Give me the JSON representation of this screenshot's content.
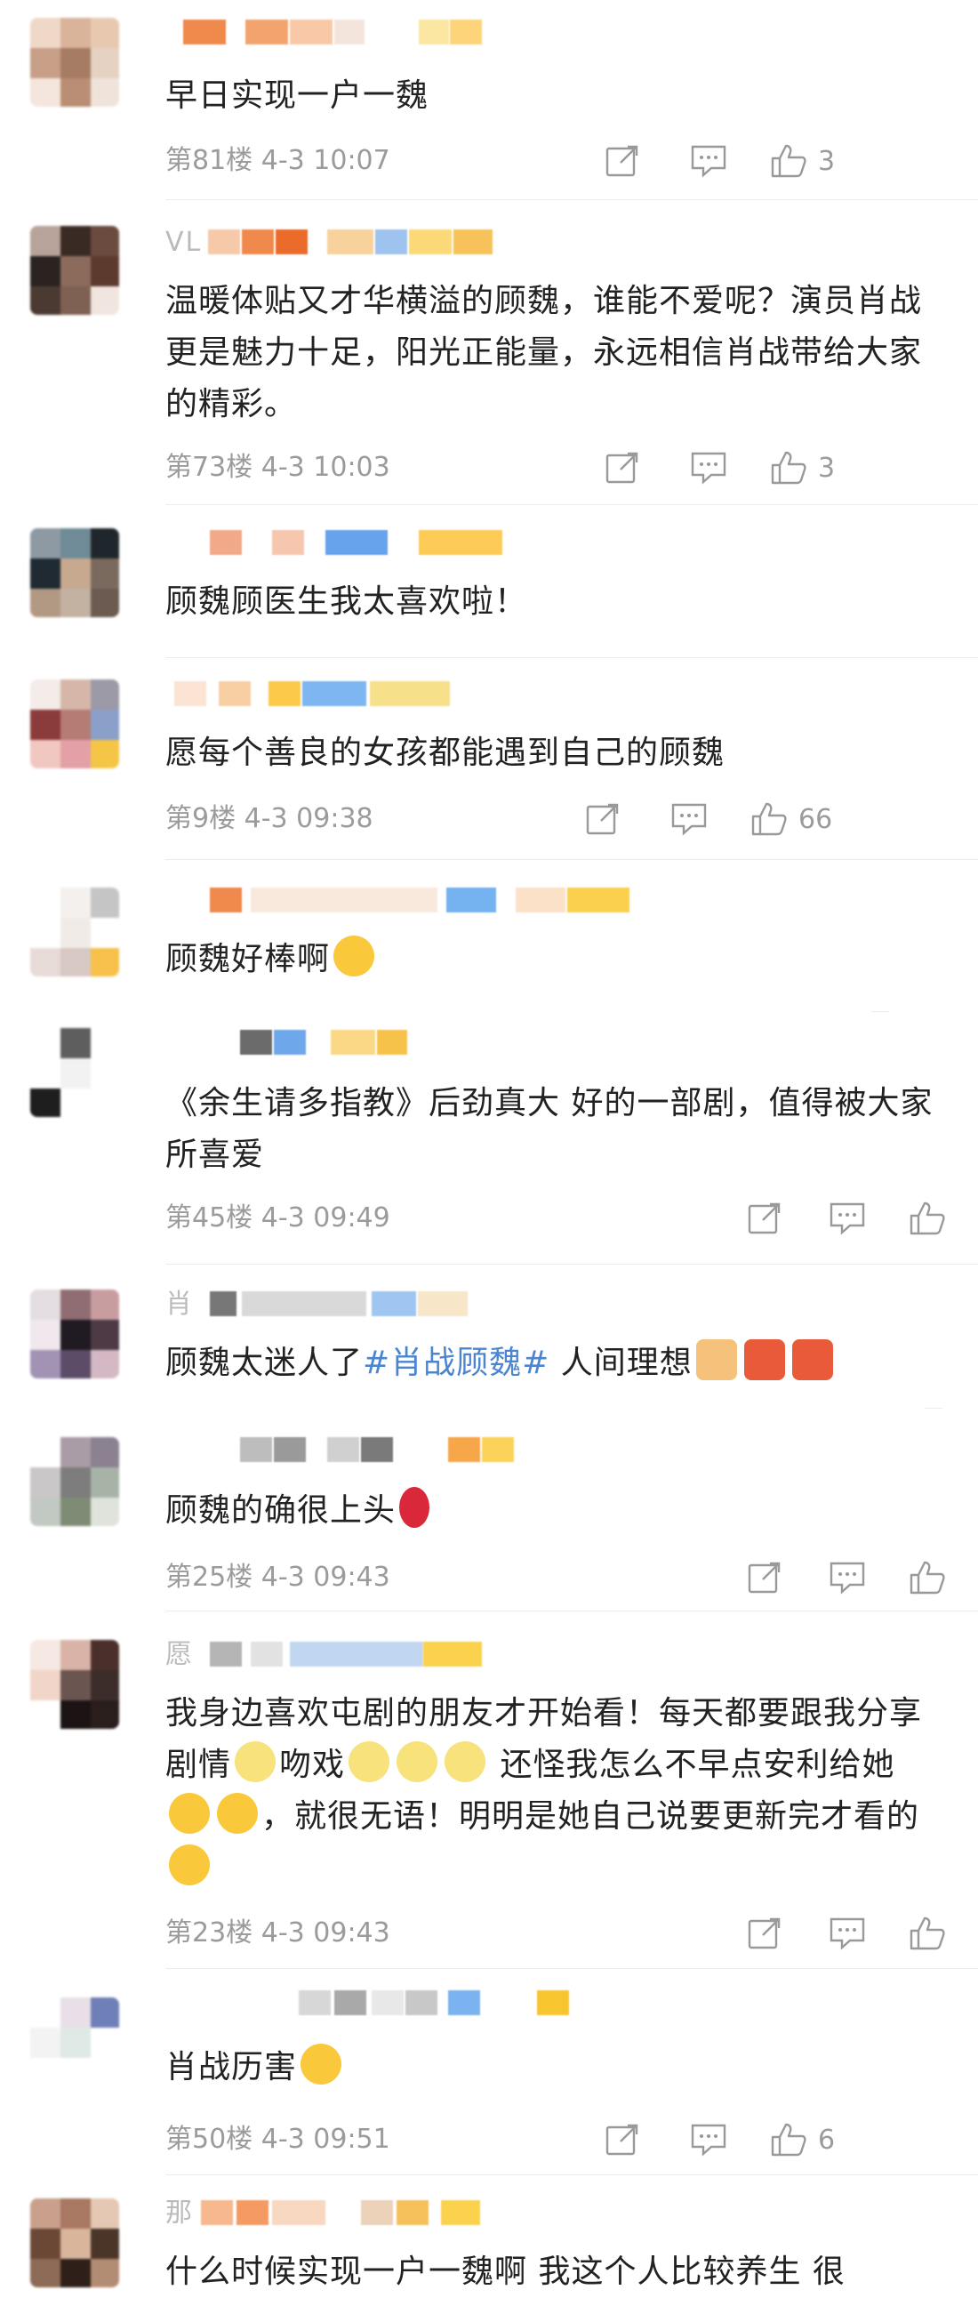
{
  "comments": [
    {
      "avatar": [
        "#f0d8c8",
        "#d9b39a",
        "#e8c9b0",
        "#c79e86",
        "#a77c65",
        "#e6d2c2"
      ],
      "name_prefix": "",
      "name_blocks": [
        "#f08a4c",
        "#f3a46e",
        "#f9c9a7",
        "#f3e5dc",
        "#fbe6a2",
        "#fdd47a"
      ],
      "text": "早日实现一户一魏",
      "floor": "第81楼",
      "time": "4-3 10:07",
      "likes": "3"
    },
    {
      "avatar": [
        "#b8a39a",
        "#3a2a24",
        "#6b4a3f",
        "#2b2320",
        "#8c6b5d",
        "#f1e5e0"
      ],
      "name_prefix": "VL",
      "name_blocks": [
        "#f6c9a8",
        "#f08a4c",
        "#ea6b2a",
        "#f8d29c",
        "#9ec3ee",
        "#fbd978",
        "#f7c25a"
      ],
      "text": "温暖体贴又才华横溢的顾魏，谁能不爱呢？演员肖战更是魅力十足，阳光正能量，永远相信肖战带给大家的精彩。",
      "floor": "第73楼",
      "time": "4-3 10:03",
      "likes": "3"
    },
    {
      "avatar": [
        "#8d9aa3",
        "#6f8b97",
        "#20272c",
        "#c7a98f",
        "#b29984",
        "#7a6a5d"
      ],
      "name_prefix": "",
      "name_blocks": [
        "#f2a98a",
        "#f6c6ae",
        "#66a3ec",
        "#fccb55"
      ],
      "text": "顾魏顾医生我太喜欢啦！",
      "floor": "",
      "time": "",
      "likes": ""
    },
    {
      "avatar": [
        "#f4ece8",
        "#d6b6a8",
        "#9b9aa6",
        "#8b3b3a",
        "#b57c74",
        "#8aa0c8"
      ],
      "name_prefix": "",
      "name_blocks": [
        "#fbe4d4",
        "#f8cfa3",
        "#fcc94a",
        "#7eb6f2",
        "#f7e08a"
      ],
      "text": "愿每个善良的女孩都能遇到自己的顾魏",
      "floor": "第9楼",
      "time": "4-3 09:38",
      "likes": "66"
    },
    {
      "avatar": [
        "#ffffff",
        "#f4f0ee",
        "#c5c5c5",
        "#ffffff",
        "#d7c8c3",
        "#f6c04b"
      ],
      "name_prefix": "",
      "name_blocks": [
        "#f08a4c",
        "#f7e0d0",
        "#74b3ef",
        "#fbe1c8",
        "#fcd04f"
      ],
      "text": "顾魏好棒啊",
      "floor": "",
      "time": "",
      "likes": ""
    },
    {
      "avatar": [
        "#ffffff",
        "#5e5e5e",
        "#ffffff",
        "#ffffff",
        "#1e1e1e",
        "#ffffff"
      ],
      "name_prefix": "",
      "name_blocks": [
        "#6b6b6b",
        "#6fa7eb",
        "#fbd886",
        "#f7c24a"
      ],
      "text": "《余生请多指教》后劲真大 好的一部剧，值得被大家所喜爱",
      "floor": "第45楼",
      "time": "4-3 09:49",
      "likes": ""
    },
    {
      "avatar": [
        "#e4dde2",
        "#8f6d73",
        "#c89da0",
        "#201a22",
        "#4d3a45",
        "#a293b5"
      ],
      "name_prefix": "肖",
      "name_blocks": [
        "#777777",
        "#c0c0c0",
        "#9fc6f1",
        "#f7e6c8"
      ],
      "text": "顾魏太迷人了#肖战顾魏# 人间理想",
      "floor": "",
      "time": "",
      "likes": ""
    },
    {
      "avatar": [
        "#a99ca6",
        "#8c8190",
        "#c9c7c7",
        "#7d7d7d",
        "#a7b3a7",
        "#7f8c75"
      ],
      "name_prefix": "",
      "name_blocks": [
        "#bdbdbd",
        "#9a9a9a",
        "#d0d0d0",
        "#7a7a7a",
        "#f7a64a",
        "#fcd35a"
      ],
      "text": "顾魏的确很上头",
      "floor": "第25楼",
      "time": "4-3 09:43",
      "likes": ""
    },
    {
      "avatar": [
        "#d9b3a7",
        "#4a2f2b",
        "#6b5550",
        "#f1d5c8",
        "#1c1414",
        "#3d2d2a"
      ],
      "name_prefix": "愿",
      "name_blocks": [
        "#b5b5b5",
        "#e2e2e2",
        "#a8c6ec",
        "#fbd24d"
      ],
      "text": "我身边喜欢屯剧的朋友才开始看！每天都要跟我分享剧情 吻戏 还怪我怎么不早点安利给她 ，就很无语！明明是她自己说要更新完才看的",
      "floor": "第23楼",
      "time": "4-3 09:43",
      "likes": ""
    },
    {
      "avatar": [
        "#ffffff",
        "#e9dfe8",
        "#6f7fb8",
        "#f3f3f3",
        "#dfe9e5",
        "#ffffff"
      ],
      "name_prefix": "",
      "name_blocks": [
        "#d7d7d7",
        "#a9a9a9",
        "#e8e8e8",
        "#c8c8c8",
        "#7ab3ef",
        "#f7c52e"
      ],
      "text": "肖战历害",
      "floor": "第50楼",
      "time": "4-3 09:51",
      "likes": "6"
    },
    {
      "avatar": [
        "#c9a08b",
        "#a87863",
        "#e4c8b3",
        "#6b4736",
        "#d9b59c",
        "#4a3528"
      ],
      "name_prefix": "那",
      "name_blocks": [
        "#f8b88e",
        "#f49a62",
        "#f8d8c0",
        "#ecd2b8",
        "#f6c15a",
        "#fbd24d"
      ],
      "text": "什么时候实现一户一魏啊 我这个人比较养生 很",
      "floor": "",
      "time": "",
      "likes": ""
    }
  ],
  "icons": {
    "share": "share-icon",
    "reply": "comment-icon",
    "like": "thumbs-up-icon"
  },
  "colors": {
    "hashtag": "#4b84cf",
    "meta": "#9b9b9b",
    "text": "#222222"
  }
}
